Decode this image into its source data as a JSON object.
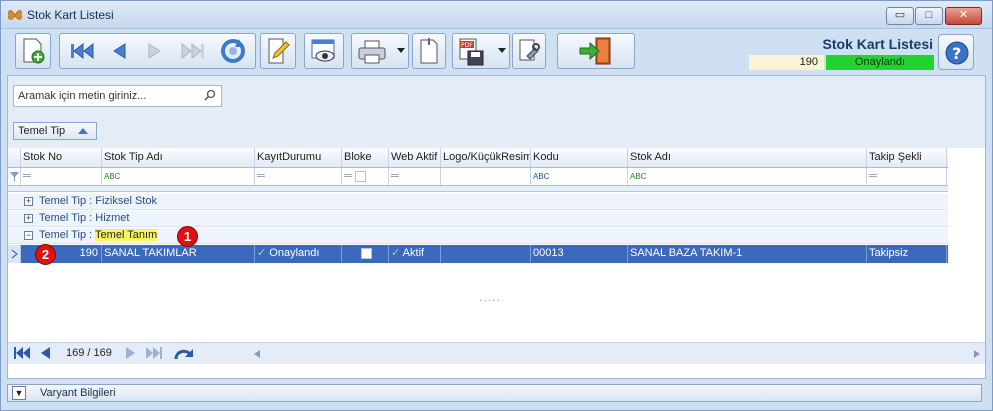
{
  "window": {
    "title": "Stok Kart Listesi",
    "minimize_label": "▭",
    "maximize_label": "□",
    "close_label": "✕"
  },
  "header": {
    "title": "Stok Kart Listesi",
    "record_number": "190",
    "status": "Onaylandı",
    "status_color": "#21d42f"
  },
  "toolbar": {
    "icons": [
      "new-document-icon",
      "first-record-icon",
      "previous-record-icon",
      "next-record-icon",
      "last-record-icon",
      "refresh-icon",
      "edit-icon",
      "preview-icon",
      "print-icon",
      "copy-icon",
      "pdf-save-icon",
      "tools-icon",
      "exit-icon",
      "help-icon"
    ]
  },
  "search": {
    "placeholder": "Aramak için metin giriniz..."
  },
  "group_chip": {
    "label": "Temel Tip"
  },
  "grid": {
    "columns": [
      "Stok No",
      "Stok Tip Adı",
      "KayıtDurumu",
      "Bloke",
      "Web Aktif",
      "Logo/KüçükResim",
      "Kodu",
      "Stok Adı",
      "Takip Şekli"
    ],
    "filter_symbols": {
      "equals": "═",
      "text": "ABC"
    },
    "groups": [
      {
        "prefix": "Temel Tip : ",
        "value": "Fiziksel Stok",
        "expanded": false
      },
      {
        "prefix": "Temel Tip : ",
        "value": "Hizmet",
        "expanded": false
      },
      {
        "prefix": "Temel Tip : ",
        "value": "Temel Tanım",
        "expanded": true
      }
    ],
    "rows": [
      {
        "stok_no": "190",
        "stok_tip_adi": "SANAL TAKIMLAR",
        "kayit_durumu": "Onaylandı",
        "bloke": "",
        "web_aktif": "Aktif",
        "logo": "",
        "kodu": "00013",
        "stok_adi": "SANAL BAZA TAKIM-1",
        "takip_sekli": "Takipsiz"
      }
    ],
    "annotations": [
      "1",
      "2"
    ]
  },
  "navigator": {
    "page_text": "169 / 169"
  },
  "bottom_panel": {
    "label": "Varyant Bilgileri"
  }
}
